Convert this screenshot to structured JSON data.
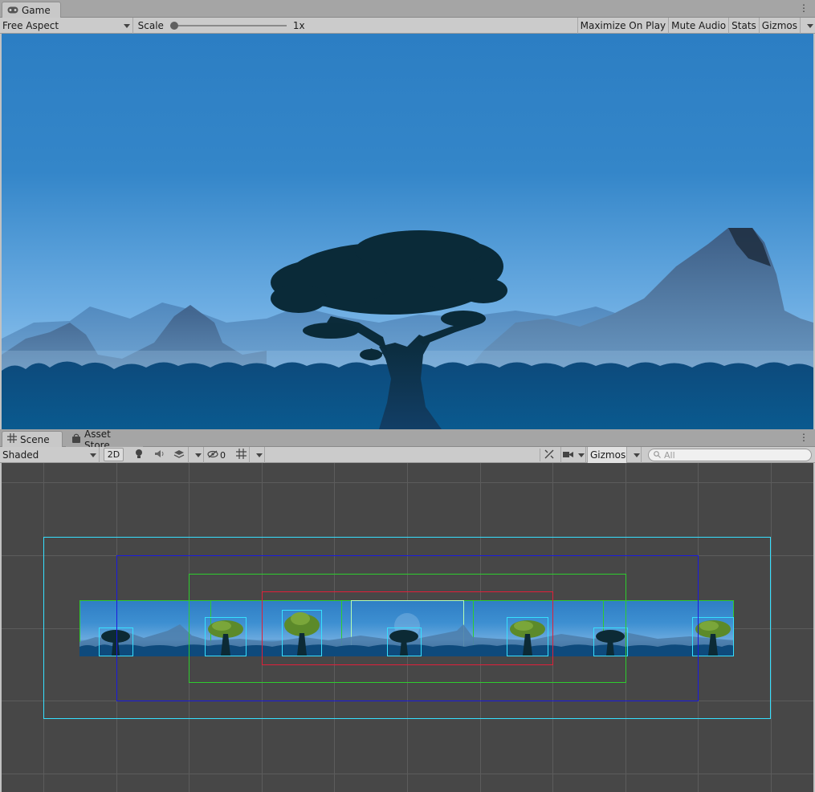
{
  "game_panel": {
    "tab_label": "Game",
    "tab_icon": "gamepad-icon",
    "aspect": "Free Aspect",
    "scale_label": "Scale",
    "scale_value": "1x",
    "scale_fraction": 0.0,
    "maximize_label": "Maximize On Play",
    "mute_label": "Mute Audio",
    "stats_label": "Stats",
    "gizmos_label": "Gizmos"
  },
  "scene_panel": {
    "tabs": [
      {
        "label": "Scene",
        "icon": "grid-icon"
      },
      {
        "label": "Asset Store",
        "icon": "bag-icon"
      }
    ],
    "shading_mode": "Shaded",
    "mode_2d": "2D",
    "hidden_count": "0",
    "gizmos_label": "Gizmos",
    "search_placeholder": "All"
  },
  "colors": {
    "sky_top": "#2c7ec3",
    "sky_bottom": "#7bb5e6",
    "scene_bg": "#474747",
    "gizmo_cyan": "#36e0ff",
    "gizmo_blue": "#1a1adf",
    "gizmo_green": "#2ecc2e",
    "gizmo_red": "#e0203a"
  }
}
